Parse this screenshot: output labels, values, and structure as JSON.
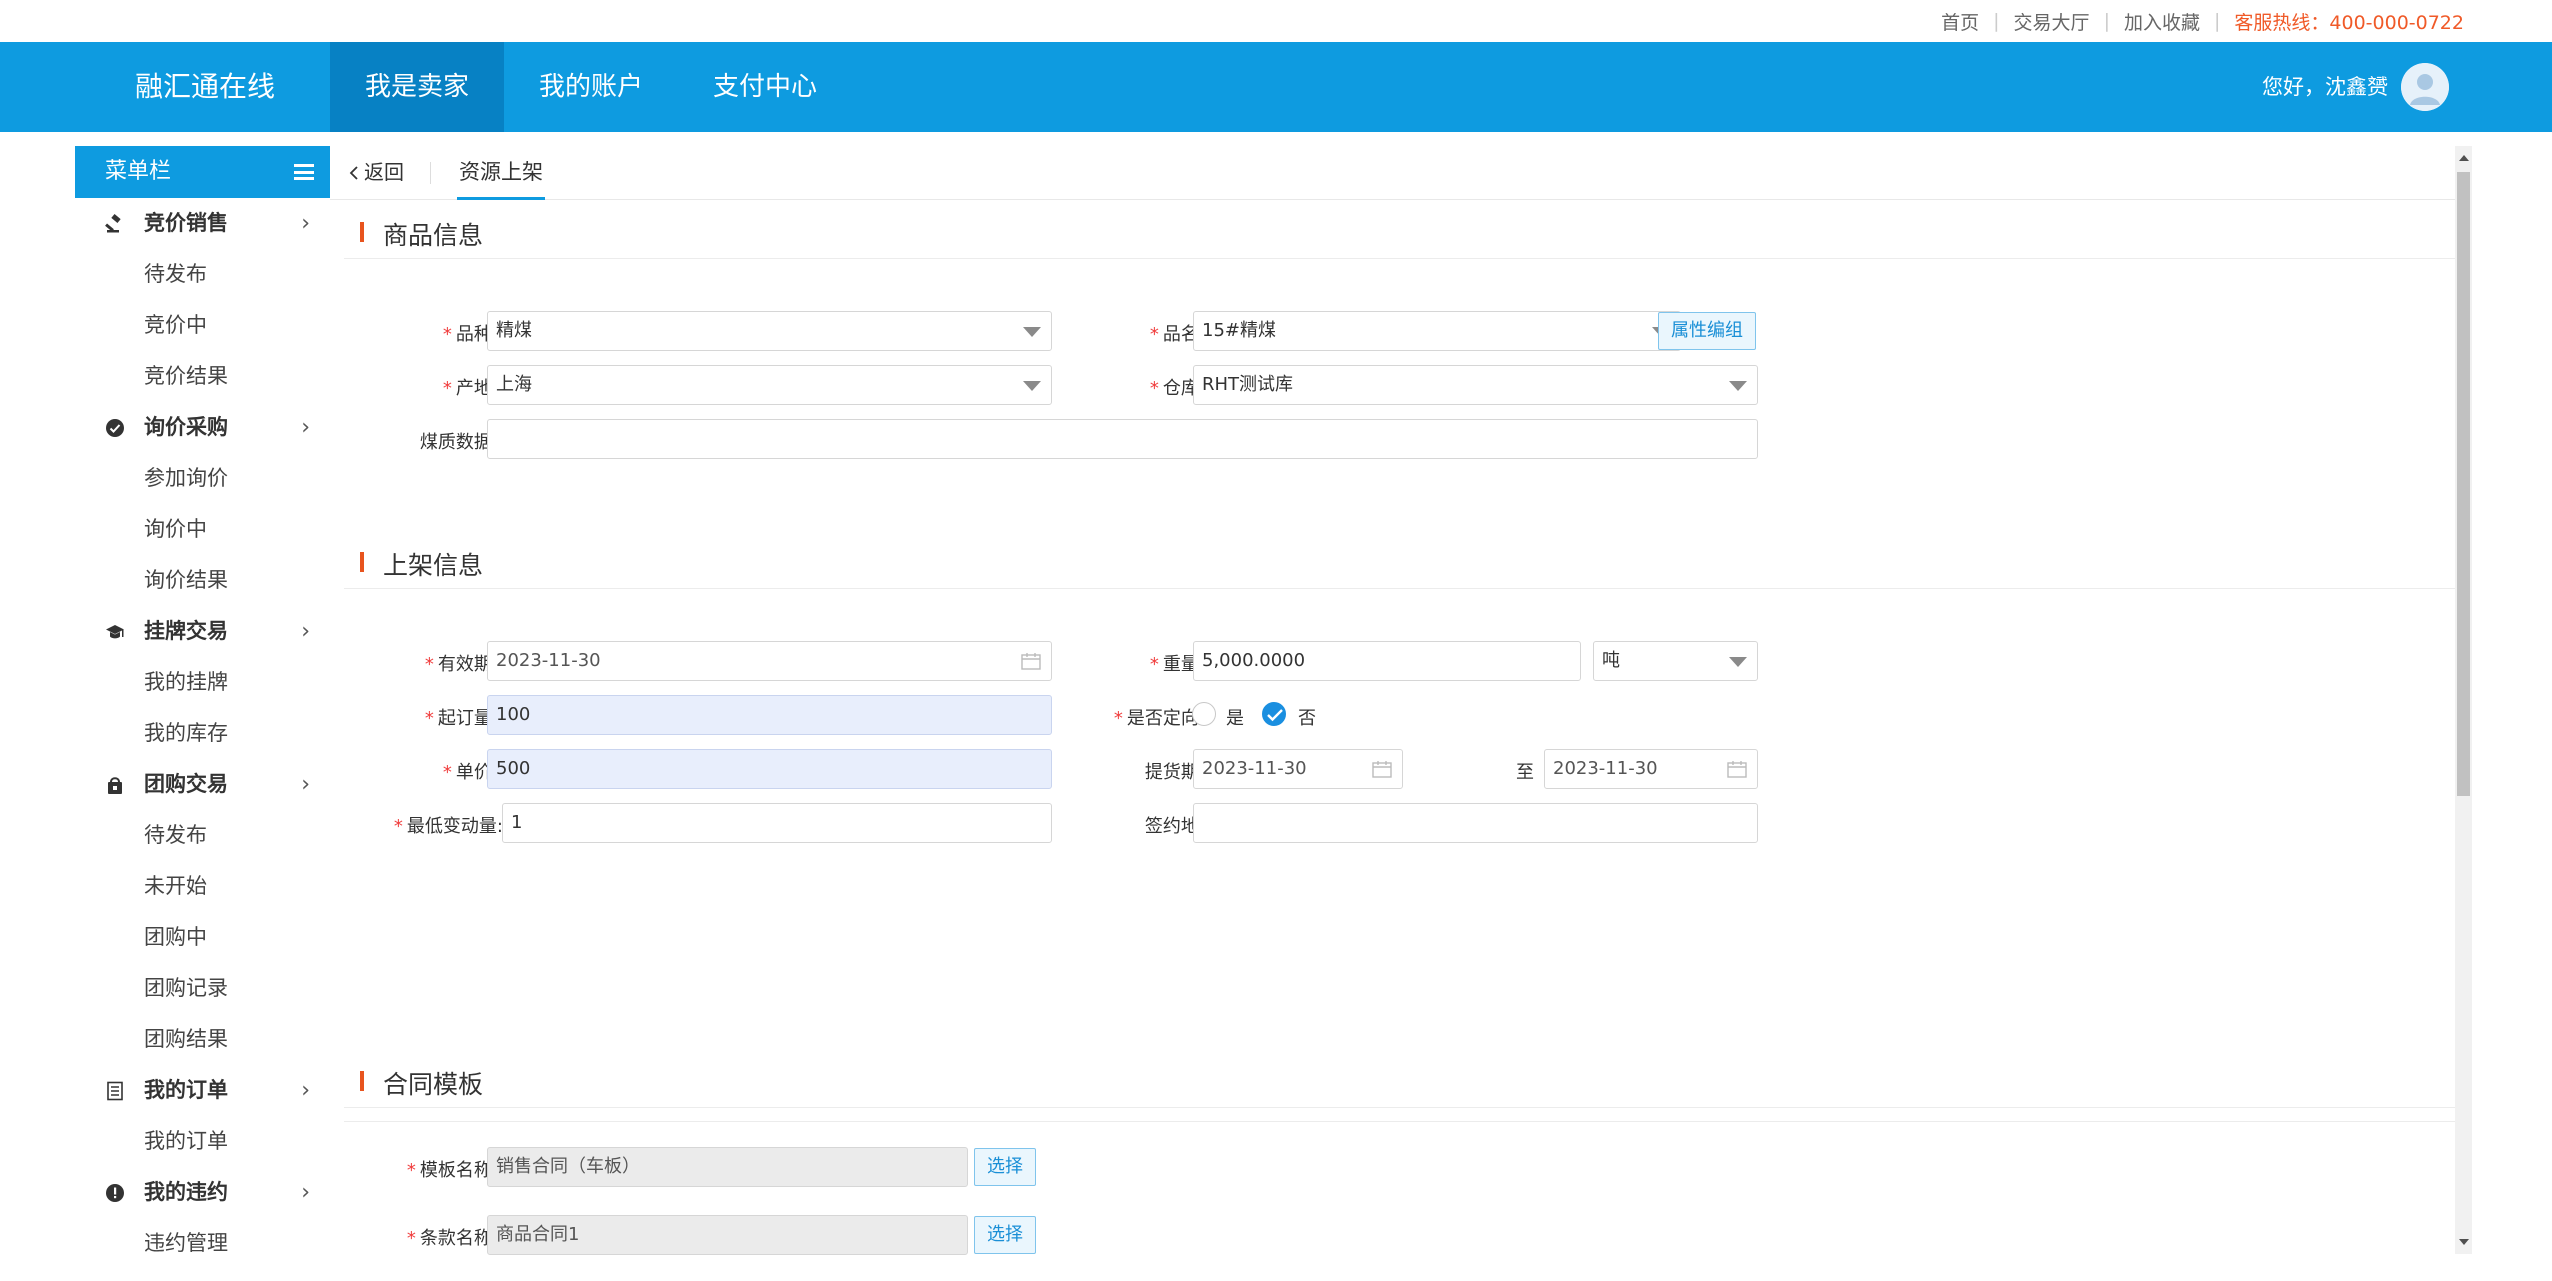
{
  "topbar": {
    "home": "首页",
    "trade_hall": "交易大厅",
    "add_favorite": "加入收藏",
    "hotline": "客服热线：400-000-0722"
  },
  "header": {
    "brand": "融汇通在线",
    "nav": [
      "我是卖家",
      "我的账户",
      "支付中心"
    ],
    "active_nav": "我是卖家",
    "greeting": "您好，沈鑫赟"
  },
  "sidebar": {
    "title": "菜单栏",
    "groups": [
      {
        "label": "竞价销售",
        "icon": "gavel-icon",
        "items": [
          "待发布",
          "竞价中",
          "竞价结果"
        ]
      },
      {
        "label": "询价采购",
        "icon": "check-circle-icon",
        "items": [
          "参加询价",
          "询价中",
          "询价结果"
        ]
      },
      {
        "label": "挂牌交易",
        "icon": "graduation-cap-icon",
        "items": [
          "我的挂牌",
          "我的库存"
        ]
      },
      {
        "label": "团购交易",
        "icon": "shopping-bag-icon",
        "items": [
          "待发布",
          "未开始",
          "团购中",
          "团购记录",
          "团购结果"
        ]
      },
      {
        "label": "我的订单",
        "icon": "document-icon",
        "items": [
          "我的订单"
        ]
      },
      {
        "label": "我的违约",
        "icon": "alert-circle-icon",
        "items": [
          "违约管理"
        ]
      }
    ]
  },
  "tabs": {
    "back": "返回",
    "current": "资源上架"
  },
  "goods_info": {
    "title": "商品信息",
    "variety_label": "品种:",
    "variety_value": "精煤",
    "name_label": "品名:",
    "name_value": "15#精煤",
    "attr_edit": "属性编组",
    "origin_label": "产地:",
    "origin_value": "上海",
    "warehouse_label": "仓库:",
    "warehouse_value": "RHT测试库",
    "quality_label": "煤质数据:",
    "quality_value": ""
  },
  "listing_info": {
    "title": "上架信息",
    "validity_label": "有效期:",
    "validity_value": "2023-11-30",
    "weight_label": "重量:",
    "weight_value": "5,000.0000",
    "unit_value": "吨",
    "min_order_label": "起订量:",
    "min_order_value": "100",
    "directional_label": "是否定向:",
    "yes": "是",
    "no": "否",
    "directional_selected": "否",
    "price_label": "单价:",
    "price_value": "500",
    "pickup_label": "提货期:",
    "pickup_from": "2023-11-30",
    "to": "至",
    "pickup_to": "2023-11-30",
    "min_change_label": "最低变动量:",
    "min_change_value": "1",
    "sign_place_label": "签约地:",
    "sign_place_value": ""
  },
  "contract": {
    "title": "合同模板",
    "template_label": "模板名称:",
    "template_value": "销售合同（车板）",
    "select": "选择",
    "clause_label": "条款名称:",
    "clause_value": "商品合同1"
  },
  "colors": {
    "brand_blue": "#0e9be0",
    "active_nav": "#0781c4",
    "accent_orange": "#e8541e",
    "required_red": "#f03c3c"
  }
}
